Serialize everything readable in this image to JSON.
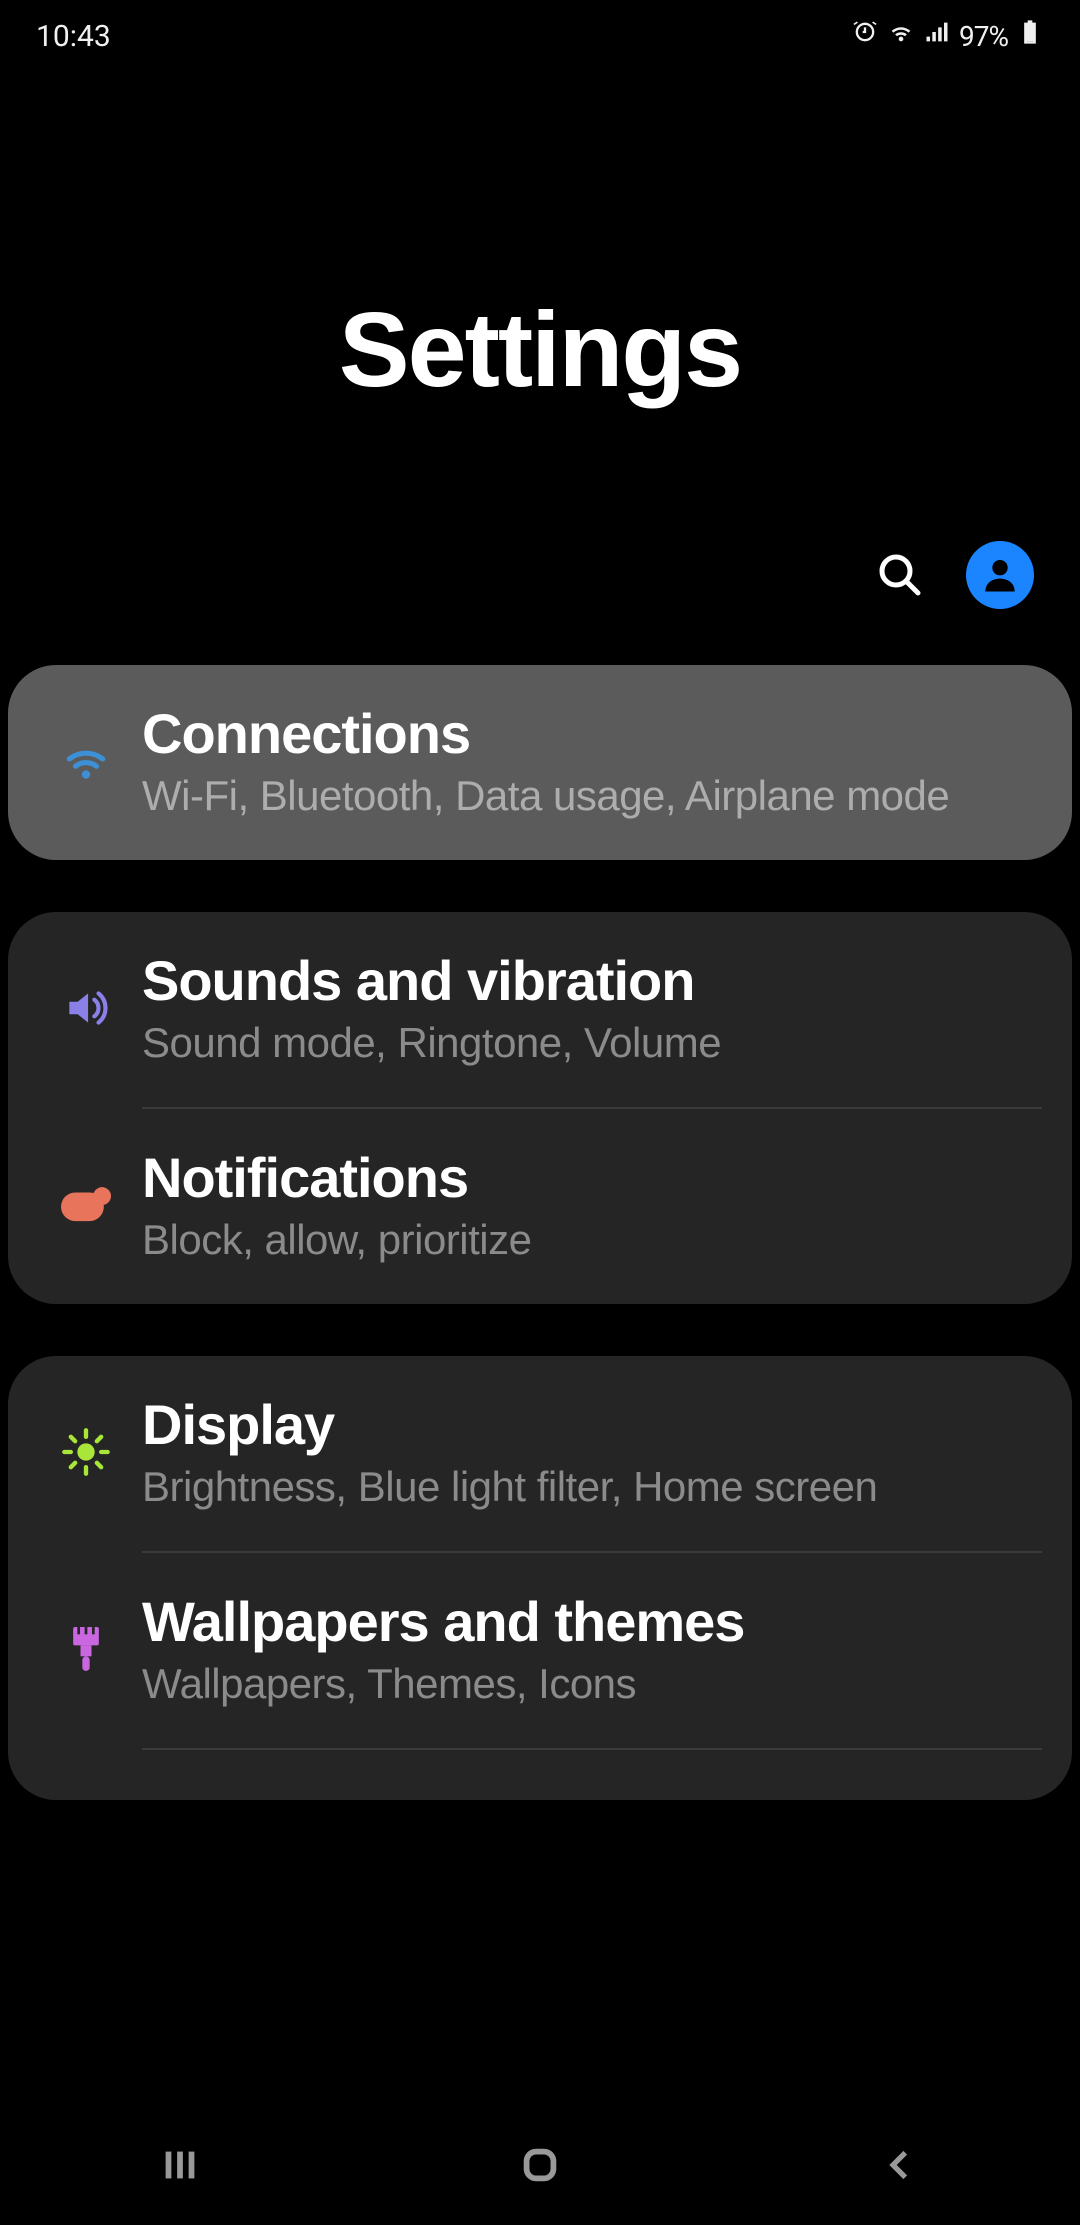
{
  "status": {
    "time": "10:43",
    "battery_text": "97%"
  },
  "page_title": "Settings",
  "groups": [
    {
      "items": [
        {
          "title": "Connections",
          "sub": "Wi-Fi, Bluetooth, Data usage, Airplane mode"
        }
      ]
    },
    {
      "items": [
        {
          "title": "Sounds and vibration",
          "sub": "Sound mode, Ringtone, Volume"
        },
        {
          "title": "Notifications",
          "sub": "Block, allow, prioritize"
        }
      ]
    },
    {
      "items": [
        {
          "title": "Display",
          "sub": "Brightness, Blue light filter, Home screen"
        },
        {
          "title": "Wallpapers and themes",
          "sub": "Wallpapers, Themes, Icons"
        }
      ]
    }
  ]
}
